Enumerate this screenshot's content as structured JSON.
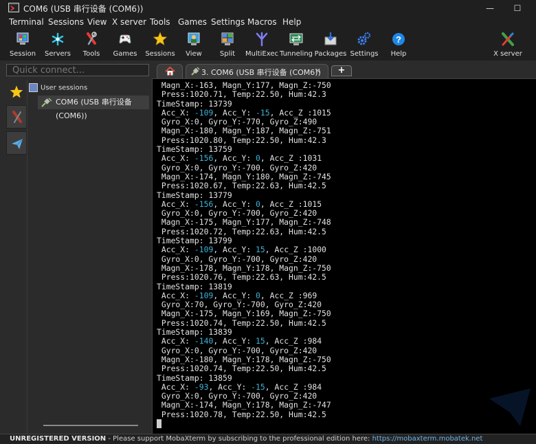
{
  "window": {
    "title": "COM6  (USB 串行设备 (COM6))",
    "minimize_glyph": "—",
    "maximize_glyph": "☐"
  },
  "menu": [
    "Terminal",
    "Sessions",
    "View",
    "X server",
    "Tools",
    "Games",
    "Settings",
    "Macros",
    "Help"
  ],
  "toolbar": [
    {
      "label": "Session",
      "icon": "session-icon"
    },
    {
      "label": "Servers",
      "icon": "servers-icon"
    },
    {
      "label": "Tools",
      "icon": "tools-icon"
    },
    {
      "label": "Games",
      "icon": "games-icon"
    },
    {
      "label": "Sessions",
      "icon": "star-icon"
    },
    {
      "label": "View",
      "icon": "view-icon"
    },
    {
      "label": "Split",
      "icon": "split-icon"
    },
    {
      "label": "MultiExec",
      "icon": "multiexec-icon"
    },
    {
      "label": "Tunneling",
      "icon": "tunneling-icon"
    },
    {
      "label": "Packages",
      "icon": "packages-icon"
    },
    {
      "label": "Settings",
      "icon": "settings-icon"
    },
    {
      "label": "Help",
      "icon": "help-icon"
    },
    {
      "label": "X server",
      "icon": "xserver-icon"
    }
  ],
  "quick_connect": {
    "placeholder": "Quick connect..."
  },
  "tabs": {
    "session_tab_label": "3. COM6  (USB 串行设备 (COM6))",
    "close_glyph": "×",
    "new_tab_glyph": "+"
  },
  "sidebar": {
    "root_label": "User sessions",
    "items": [
      {
        "label": "COM6  (USB 串行设备 (COM6))"
      }
    ]
  },
  "terminal": {
    "lines": [
      " Magn_X:-163, Magn_Y:177, Magn_Z:-750",
      " Press:1020.71, Temp:22.50, Hum:42.3",
      "TimeStamp: 13739",
      " Acc_X: -109, Acc_Y: -15, Acc_Z :1015",
      " Gyro_X:0, Gyro_Y:-770, Gyro_Z:490",
      " Magn_X:-180, Magn_Y:187, Magn_Z:-751",
      " Press:1020.80, Temp:22.50, Hum:42.3",
      "TimeStamp: 13759",
      " Acc_X: -156, Acc_Y: 0, Acc_Z :1031",
      " Gyro_X:0, Gyro_Y:-700, Gyro_Z:420",
      " Magn_X:-174, Magn_Y:180, Magn_Z:-745",
      " Press:1020.67, Temp:22.63, Hum:42.5",
      "TimeStamp: 13779",
      " Acc_X: -156, Acc_Y: 0, Acc_Z :1015",
      " Gyro_X:0, Gyro_Y:-700, Gyro_Z:420",
      " Magn_X:-175, Magn_Y:177, Magn_Z:-748",
      " Press:1020.72, Temp:22.63, Hum:42.5",
      "TimeStamp: 13799",
      " Acc_X: -109, Acc_Y: 15, Acc_Z :1000",
      " Gyro_X:0, Gyro_Y:-700, Gyro_Z:420",
      " Magn_X:-178, Magn_Y:178, Magn_Z:-750",
      " Press:1020.76, Temp:22.63, Hum:42.5",
      "TimeStamp: 13819",
      " Acc_X: -109, Acc_Y: 0, Acc_Z :969",
      " Gyro_X:70, Gyro_Y:-700, Gyro_Z:420",
      " Magn_X:-175, Magn_Y:169, Magn_Z:-750",
      " Press:1020.74, Temp:22.50, Hum:42.5",
      "TimeStamp: 13839",
      " Acc_X: -140, Acc_Y: 15, Acc_Z :984",
      " Gyro_X:0, Gyro_Y:-700, Gyro_Z:420",
      " Magn_X:-180, Magn_Y:178, Magn_Z:-750",
      " Press:1020.74, Temp:22.50, Hum:42.5",
      "TimeStamp: 13859",
      " Acc_X: -93, Acc_Y: -15, Acc_Z :984",
      " Gyro_X:0, Gyro_Y:-700, Gyro_Z:420",
      " Magn_X:-174, Magn_Y:178, Magn_Z:-747",
      " Press:1020.78, Temp:22.50, Hum:42.5"
    ],
    "highlight_color": "#3fb3d9"
  },
  "statusbar": {
    "unregistered": "UNREGISTERED VERSION",
    "message": "  -  Please support MobaXterm by subscribing to the professional edition here:  ",
    "link": "https://mobaxterm.mobatek.net"
  }
}
